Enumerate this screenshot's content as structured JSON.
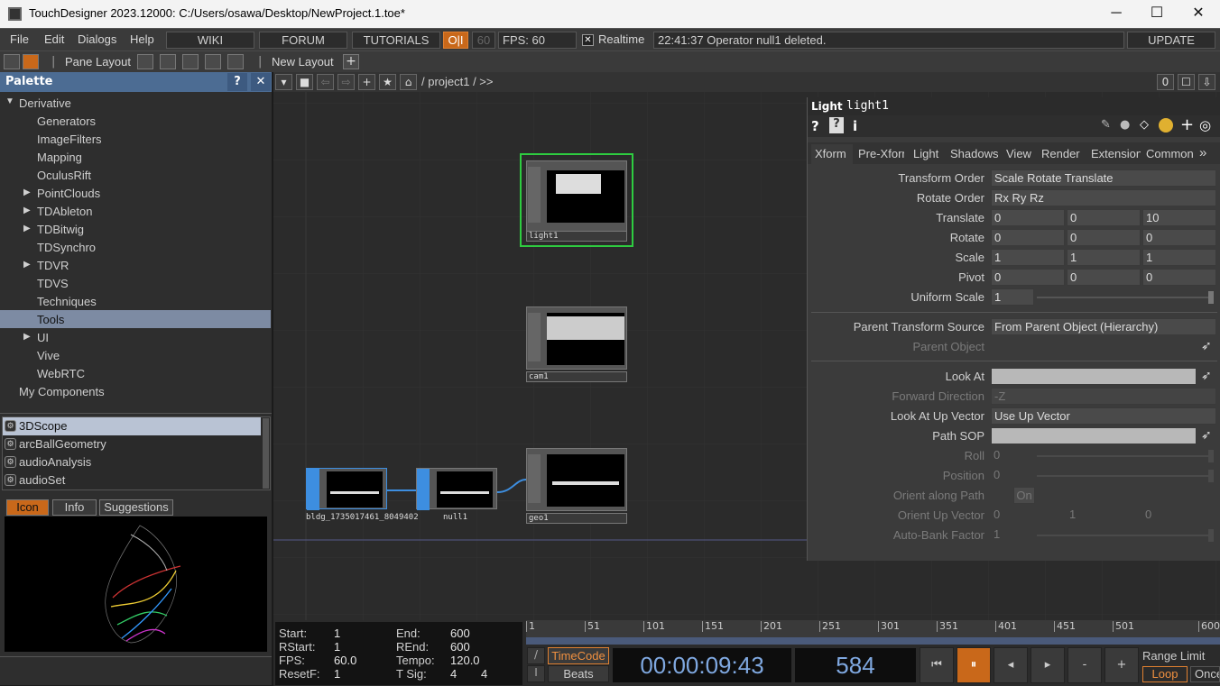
{
  "window": {
    "title": "TouchDesigner 2023.12000: C:/Users/osawa/Desktop/NewProject.1.toe*",
    "minimize": "─",
    "maximize": "☐",
    "close": "✕"
  },
  "menubar": {
    "items": [
      "File",
      "Edit",
      "Dialogs",
      "Help"
    ],
    "wiki": "WIKI",
    "forum": "FORUM",
    "tutorials": "TUTORIALS",
    "oi": "O|I",
    "fps_target": "60",
    "fps_label": "FPS:",
    "fps_value": "60",
    "realtime_label": "Realtime",
    "status": "22:41:37 Operator null1 deleted.",
    "update": "UPDATE"
  },
  "layoutbar": {
    "pane_layout": "Pane Layout",
    "new_layout": "New Layout",
    "plus": "+"
  },
  "palette": {
    "title": "Palette",
    "help": "?",
    "close": "✕",
    "root": "Derivative",
    "items": [
      {
        "label": "Generators",
        "expandable": false
      },
      {
        "label": "ImageFilters",
        "expandable": false
      },
      {
        "label": "Mapping",
        "expandable": false
      },
      {
        "label": "OculusRift",
        "expandable": false
      },
      {
        "label": "PointClouds",
        "expandable": true
      },
      {
        "label": "TDAbleton",
        "expandable": true
      },
      {
        "label": "TDBitwig",
        "expandable": true
      },
      {
        "label": "TDSynchro",
        "expandable": false
      },
      {
        "label": "TDVR",
        "expandable": true
      },
      {
        "label": "TDVS",
        "expandable": false
      },
      {
        "label": "Techniques",
        "expandable": false
      },
      {
        "label": "Tools",
        "expandable": false,
        "selected": true
      },
      {
        "label": "UI",
        "expandable": true
      },
      {
        "label": "Vive",
        "expandable": false
      },
      {
        "label": "WebRTC",
        "expandable": false
      }
    ],
    "my_components": "My Components",
    "components": [
      "3DScope",
      "arcBallGeometry",
      "audioAnalysis",
      "audioSet"
    ],
    "tabs": [
      "Icon",
      "Info",
      "Suggestions"
    ]
  },
  "network": {
    "path": "/ project1 / >>",
    "counter": "0",
    "nodes": [
      {
        "name": "light1",
        "selected": true
      },
      {
        "name": "cam1"
      },
      {
        "name": "bldg_1735017461_8049402"
      },
      {
        "name": "null1"
      },
      {
        "name": "geo1"
      }
    ]
  },
  "params": {
    "type": "Light",
    "name": "light1",
    "tabs": [
      "Xform",
      "Pre-Xform",
      "Light",
      "Shadows",
      "View",
      "Render",
      "Extension",
      "Common"
    ],
    "active_tab": "Xform",
    "rows": [
      {
        "label": "Transform Order",
        "kind": "menu",
        "value": "Scale Rotate Translate"
      },
      {
        "label": "Rotate Order",
        "kind": "menu",
        "value": "Rx Ry Rz"
      },
      {
        "label": "Translate",
        "kind": "xyz",
        "values": [
          "0",
          "0",
          "10"
        ]
      },
      {
        "label": "Rotate",
        "kind": "xyz",
        "values": [
          "0",
          "0",
          "0"
        ]
      },
      {
        "label": "Scale",
        "kind": "xyz",
        "values": [
          "1",
          "1",
          "1"
        ]
      },
      {
        "label": "Pivot",
        "kind": "xyz",
        "values": [
          "0",
          "0",
          "0"
        ]
      },
      {
        "label": "Uniform Scale",
        "kind": "slider",
        "value": "1"
      },
      {
        "label": "Parent Transform Source",
        "kind": "menu",
        "value": "From Parent Object (Hierarchy)"
      },
      {
        "label": "Parent Object",
        "kind": "dim",
        "value": ""
      },
      {
        "label": "Look At",
        "kind": "field",
        "value": ""
      },
      {
        "label": "Forward Direction",
        "kind": "dimmenu",
        "value": "-Z"
      },
      {
        "label": "Look At Up Vector",
        "kind": "menu",
        "value": "Use Up Vector"
      },
      {
        "label": "Path SOP",
        "kind": "field",
        "value": ""
      },
      {
        "label": "Roll",
        "kind": "dimslider",
        "value": "0"
      },
      {
        "label": "Position",
        "kind": "dimslider",
        "value": "0"
      },
      {
        "label": "Orient along Path",
        "kind": "dimtoggle",
        "value": "On"
      },
      {
        "label": "Orient Up Vector",
        "kind": "dimxyz",
        "values": [
          "0",
          "1",
          "0"
        ]
      },
      {
        "label": "Auto-Bank Factor",
        "kind": "dimslider",
        "value": "1"
      }
    ]
  },
  "timeline": {
    "start_label": "Start:",
    "start": "1",
    "end_label": "End:",
    "end": "600",
    "rstart_label": "RStart:",
    "rstart": "1",
    "rend_label": "REnd:",
    "rend": "600",
    "fps_label": "FPS:",
    "fps": "60.0",
    "tempo_label": "Tempo:",
    "tempo": "120.0",
    "resetf_label": "ResetF:",
    "resetf": "1",
    "tsig_label": "T Sig:",
    "tsig_a": "4",
    "tsig_b": "4",
    "ruler": [
      "1",
      "51",
      "101",
      "151",
      "201",
      "251",
      "301",
      "351",
      "401",
      "451",
      "501",
      "600"
    ],
    "timecode_btn": "TimeCode",
    "beats_btn": "Beats",
    "timecode": "00:00:09:43",
    "frame": "584",
    "range_limit": "Range Limit",
    "loop": "Loop",
    "once": "Once",
    "minus": "-",
    "plus": "+"
  }
}
